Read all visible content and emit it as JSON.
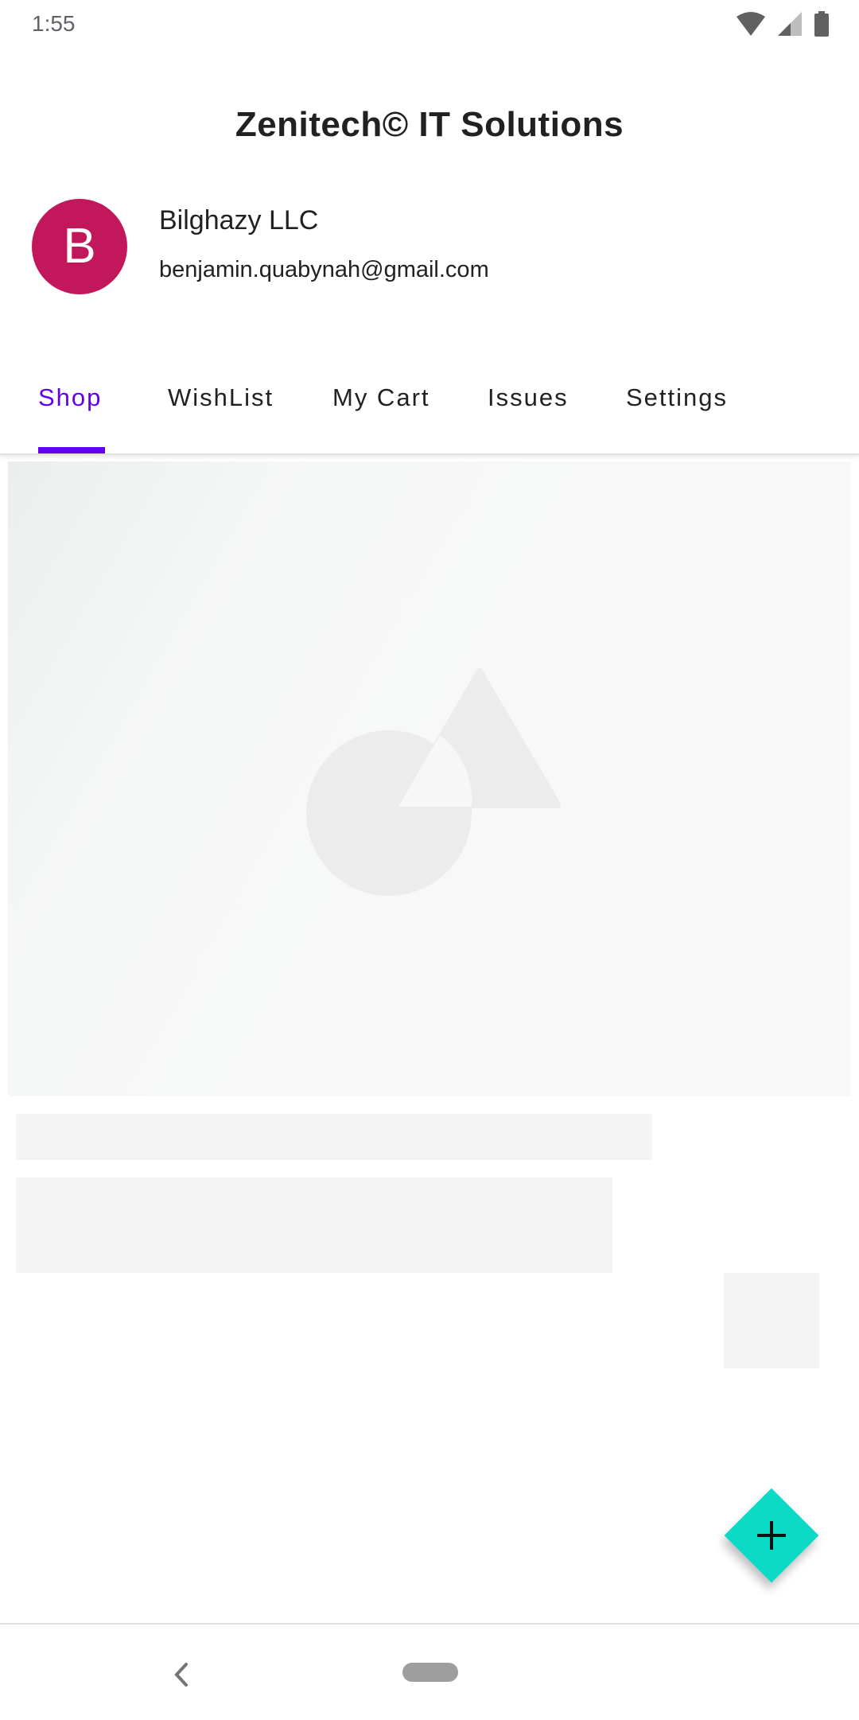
{
  "status_bar": {
    "time": "1:55",
    "icons": [
      "wifi-icon",
      "cell-signal-icon",
      "battery-icon"
    ]
  },
  "header": {
    "title": "Zenitech© IT Solutions",
    "avatar_letter": "B",
    "profile_name": "Bilghazy LLC",
    "profile_email": "benjamin.quabynah@gmail.com"
  },
  "tabs": [
    {
      "label": "Shop",
      "active": true
    },
    {
      "label": "WishList",
      "active": false
    },
    {
      "label": "My Cart",
      "active": false
    },
    {
      "label": "Issues",
      "active": false
    },
    {
      "label": "Settings",
      "active": false
    }
  ],
  "fab": {
    "icon": "plus-icon"
  },
  "nav_bar": {
    "icons": [
      "back-icon",
      "home-pill-icon"
    ]
  },
  "colors": {
    "accent": "#6200ee",
    "avatar": "#c2185b",
    "fab": "#0bdac6",
    "placeholder": "#f8f8f8"
  }
}
